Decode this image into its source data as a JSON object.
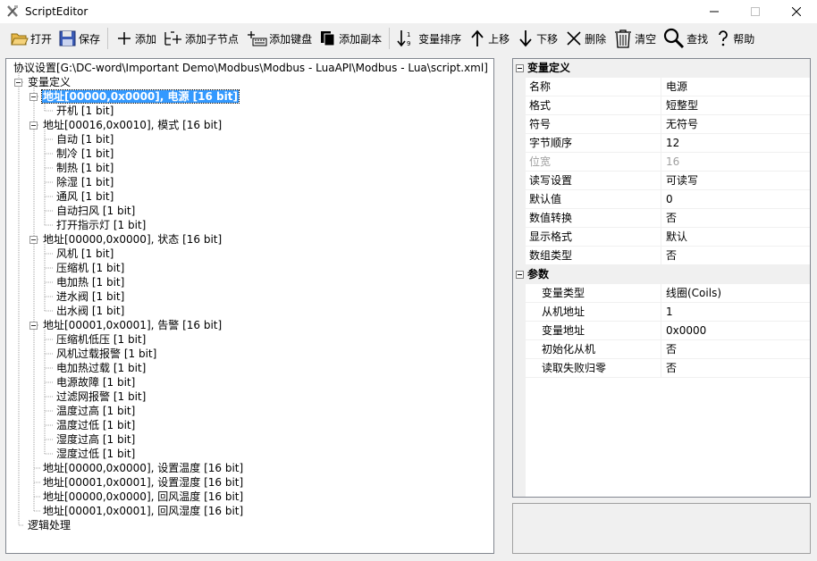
{
  "window": {
    "title": "ScriptEditor"
  },
  "toolbar": {
    "open": "打开",
    "save": "保存",
    "add": "添加",
    "add_child": "添加子节点",
    "add_key": "添加键盘",
    "add_copy": "添加副本",
    "sort": "变量排序",
    "move_up": "上移",
    "move_down": "下移",
    "delete": "删除",
    "clear": "清空",
    "find": "查找",
    "help": "帮助"
  },
  "tree": {
    "root": "协议设置[G:\\DC-word\\Important Demo\\Modbus\\Modbus - LuaAPI\\Modbus - Lua\\script.xml]",
    "var_def": "变量定义",
    "groups": [
      {
        "label": "地址[00000,0x0000], 电源 [16 bit]",
        "children": [
          "开机 [1 bit]"
        ]
      },
      {
        "label": "地址[00016,0x0010], 模式 [16 bit]",
        "children": [
          "自动 [1 bit]",
          "制冷 [1 bit]",
          "制热 [1 bit]",
          "除湿 [1 bit]",
          "通风 [1 bit]",
          "自动扫风 [1 bit]",
          "打开指示灯 [1 bit]"
        ]
      },
      {
        "label": "地址[00000,0x0000], 状态 [16 bit]",
        "children": [
          "风机 [1 bit]",
          "压缩机 [1 bit]",
          "电加热 [1 bit]",
          "进水阀 [1 bit]",
          "出水阀 [1 bit]"
        ]
      },
      {
        "label": "地址[00001,0x0001], 告警 [16 bit]",
        "children": [
          "压缩机低压 [1 bit]",
          "风机过载报警 [1 bit]",
          "电加热过载 [1 bit]",
          "电源故障 [1 bit]",
          "过滤网报警 [1 bit]",
          "温度过高 [1 bit]",
          "温度过低 [1 bit]",
          "湿度过高 [1 bit]",
          "湿度过低 [1 bit]"
        ]
      }
    ],
    "leaves": [
      "地址[00000,0x0000], 设置温度 [16 bit]",
      "地址[00001,0x0001], 设置湿度 [16 bit]",
      "地址[00000,0x0000], 回风温度 [16 bit]",
      "地址[00001,0x0001], 回风湿度 [16 bit]"
    ],
    "logic": "逻辑处理"
  },
  "props": {
    "cat_var": "变量定义",
    "cat_param": "参数",
    "var_rows": [
      {
        "name": "名称",
        "value": "电源"
      },
      {
        "name": "格式",
        "value": "短整型"
      },
      {
        "name": "符号",
        "value": "无符号"
      },
      {
        "name": "字节顺序",
        "value": "12"
      },
      {
        "name": "位宽",
        "value": "16",
        "disabled": true
      },
      {
        "name": "读写设置",
        "value": "可读写"
      },
      {
        "name": "默认值",
        "value": "0"
      },
      {
        "name": "数值转换",
        "value": "否"
      },
      {
        "name": "显示格式",
        "value": "默认"
      },
      {
        "name": "数组类型",
        "value": "否"
      }
    ],
    "param_rows": [
      {
        "name": "变量类型",
        "value": "线圈(Coils)"
      },
      {
        "name": "从机地址",
        "value": "1"
      },
      {
        "name": "变量地址",
        "value": "0x0000"
      },
      {
        "name": "初始化从机",
        "value": "否"
      },
      {
        "name": "读取失败归零",
        "value": "否"
      }
    ]
  }
}
